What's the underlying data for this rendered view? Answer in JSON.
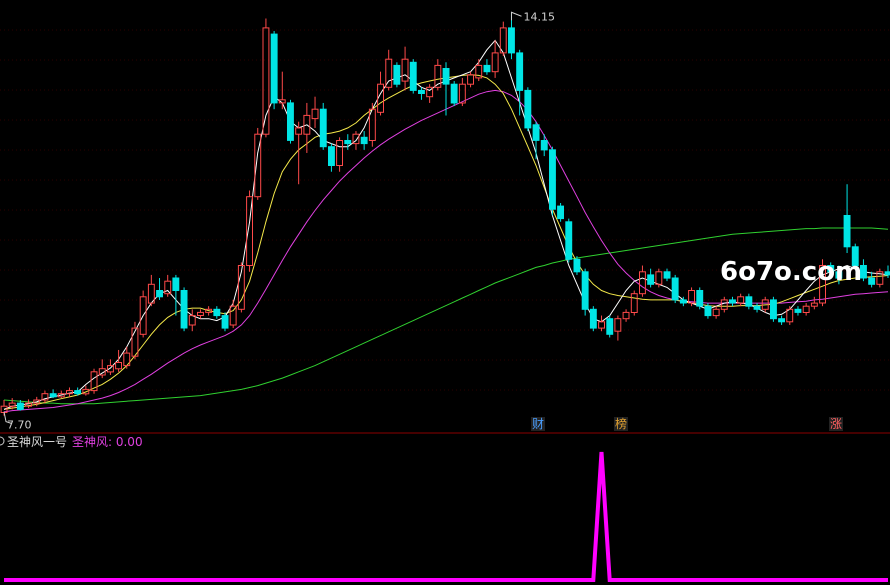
{
  "colors": {
    "background": "#000000",
    "up": "#ff4a4a",
    "down": "#00e5e5",
    "ma5": "#ffffff",
    "ma10": "#f5e94a",
    "ma20": "#e040e0",
    "ma60": "#30d030",
    "grid": "#8b0000",
    "indicator": "#ff00ff"
  },
  "price_chart": {
    "high_label": "14.15",
    "low_label": "7.70",
    "watermark": "6o7o.com",
    "event_markers": [
      {
        "text": "财",
        "color": "#4a9eff",
        "bg": "#222"
      },
      {
        "text": "榜",
        "color": "#e0a030",
        "bg": "#222"
      },
      {
        "text": "涨",
        "color": "#ff6060",
        "bg": "#222"
      }
    ]
  },
  "indicator_panel": {
    "title": "圣神风一号",
    "series_label": "圣神风: 0.00"
  },
  "chart_data": [
    {
      "type": "candlestick",
      "ylim": [
        7.55,
        14.25
      ],
      "max_price": 14.15,
      "min_price": 7.7,
      "candles": [
        [
          7.75,
          7.85,
          7.7,
          7.95
        ],
        [
          7.85,
          7.9,
          7.8,
          7.98
        ],
        [
          7.9,
          7.8,
          7.78,
          7.95
        ],
        [
          7.85,
          7.9,
          7.82,
          7.96
        ],
        [
          7.9,
          7.95,
          7.85,
          8.0
        ],
        [
          7.95,
          8.05,
          7.9,
          8.1
        ],
        [
          8.05,
          8.0,
          7.98,
          8.12
        ],
        [
          8.0,
          8.05,
          7.98,
          8.1
        ],
        [
          8.05,
          8.1,
          8.0,
          8.15
        ],
        [
          8.1,
          8.05,
          8.02,
          8.15
        ],
        [
          8.05,
          8.12,
          8.02,
          8.18
        ],
        [
          8.1,
          8.4,
          8.05,
          8.45
        ],
        [
          8.35,
          8.45,
          8.3,
          8.6
        ],
        [
          8.4,
          8.5,
          8.35,
          8.6
        ],
        [
          8.45,
          8.55,
          8.4,
          8.75
        ],
        [
          8.5,
          8.7,
          8.45,
          8.8
        ],
        [
          8.65,
          9.1,
          8.6,
          9.2
        ],
        [
          9.0,
          9.6,
          8.95,
          9.7
        ],
        [
          9.5,
          9.8,
          9.45,
          9.95
        ],
        [
          9.7,
          9.6,
          9.55,
          9.9
        ],
        [
          9.65,
          9.85,
          9.6,
          9.95
        ],
        [
          9.9,
          9.7,
          9.3,
          9.95
        ],
        [
          9.7,
          9.1,
          9.05,
          9.75
        ],
        [
          9.15,
          9.3,
          9.05,
          9.4
        ],
        [
          9.3,
          9.35,
          9.25,
          9.4
        ],
        [
          9.35,
          9.4,
          9.3,
          9.45
        ],
        [
          9.4,
          9.3,
          9.25,
          9.45
        ],
        [
          9.3,
          9.1,
          9.05,
          9.35
        ],
        [
          9.15,
          9.45,
          9.1,
          9.55
        ],
        [
          9.4,
          10.1,
          9.35,
          10.15
        ],
        [
          10.1,
          11.2,
          10.0,
          11.3
        ],
        [
          11.2,
          12.2,
          11.15,
          12.3
        ],
        [
          12.2,
          13.9,
          12.15,
          14.05
        ],
        [
          13.8,
          12.7,
          12.6,
          13.85
        ],
        [
          12.7,
          12.75,
          12.6,
          13.2
        ],
        [
          12.7,
          12.1,
          12.05,
          12.75
        ],
        [
          12.2,
          12.3,
          11.4,
          12.4
        ],
        [
          12.2,
          12.5,
          11.9,
          12.7
        ],
        [
          12.45,
          12.6,
          12.3,
          12.8
        ],
        [
          12.6,
          12.0,
          11.95,
          12.7
        ],
        [
          12.0,
          11.7,
          11.6,
          12.05
        ],
        [
          11.7,
          12.1,
          11.6,
          12.15
        ],
        [
          12.1,
          12.05,
          11.95,
          12.2
        ],
        [
          12.05,
          12.2,
          11.95,
          12.25
        ],
        [
          12.15,
          12.05,
          11.95,
          12.25
        ],
        [
          12.1,
          12.6,
          12.0,
          12.7
        ],
        [
          12.55,
          13.0,
          12.5,
          13.2
        ],
        [
          12.95,
          13.4,
          12.9,
          13.55
        ],
        [
          13.3,
          13.0,
          12.95,
          13.35
        ],
        [
          13.05,
          13.4,
          12.9,
          13.6
        ],
        [
          13.35,
          12.9,
          12.85,
          13.4
        ],
        [
          12.9,
          12.85,
          12.75,
          12.95
        ],
        [
          12.8,
          12.95,
          12.7,
          13.0
        ],
        [
          12.95,
          13.3,
          12.9,
          13.4
        ],
        [
          13.25,
          13.0,
          12.5,
          13.35
        ],
        [
          13.0,
          12.7,
          12.65,
          13.05
        ],
        [
          12.7,
          13.0,
          12.65,
          13.1
        ],
        [
          13.0,
          13.15,
          12.95,
          13.2
        ],
        [
          13.1,
          13.3,
          13.05,
          13.4
        ],
        [
          13.3,
          13.2,
          13.15,
          13.4
        ],
        [
          13.2,
          13.5,
          13.1,
          13.7
        ],
        [
          13.5,
          13.9,
          13.45,
          14.0
        ],
        [
          13.9,
          13.5,
          13.4,
          14.15
        ],
        [
          13.5,
          12.9,
          12.5,
          13.55
        ],
        [
          12.9,
          12.3,
          12.25,
          12.95
        ],
        [
          12.35,
          12.1,
          11.8,
          12.4
        ],
        [
          12.1,
          11.95,
          11.85,
          12.2
        ],
        [
          11.95,
          11.0,
          10.9,
          12.0
        ],
        [
          11.05,
          10.85,
          10.8,
          11.1
        ],
        [
          10.8,
          10.2,
          10.15,
          10.85
        ],
        [
          10.2,
          10.0,
          9.95,
          10.25
        ],
        [
          10.0,
          9.4,
          9.3,
          10.05
        ],
        [
          9.4,
          9.1,
          9.05,
          9.45
        ],
        [
          9.1,
          9.2,
          9.05,
          9.3
        ],
        [
          9.25,
          9.0,
          8.95,
          9.3
        ],
        [
          9.05,
          9.25,
          8.9,
          9.3
        ],
        [
          9.25,
          9.35,
          9.2,
          9.4
        ],
        [
          9.35,
          9.65,
          9.3,
          9.7
        ],
        [
          9.65,
          10.0,
          9.6,
          10.1
        ],
        [
          9.95,
          9.8,
          9.75,
          10.05
        ],
        [
          9.8,
          10.0,
          9.75,
          10.05
        ],
        [
          10.0,
          9.9,
          9.85,
          10.05
        ],
        [
          9.9,
          9.55,
          9.5,
          9.95
        ],
        [
          9.55,
          9.5,
          9.45,
          9.6
        ],
        [
          9.5,
          9.7,
          9.45,
          9.75
        ],
        [
          9.7,
          9.45,
          9.4,
          9.75
        ],
        [
          9.45,
          9.3,
          9.25,
          9.5
        ],
        [
          9.3,
          9.4,
          9.25,
          9.45
        ],
        [
          9.4,
          9.55,
          9.35,
          9.6
        ],
        [
          9.55,
          9.5,
          9.45,
          9.6
        ],
        [
          9.5,
          9.6,
          9.45,
          9.65
        ],
        [
          9.6,
          9.45,
          9.4,
          9.65
        ],
        [
          9.45,
          9.4,
          9.35,
          9.5
        ],
        [
          9.4,
          9.55,
          9.35,
          9.6
        ],
        [
          9.55,
          9.25,
          9.2,
          9.6
        ],
        [
          9.25,
          9.2,
          9.15,
          9.3
        ],
        [
          9.2,
          9.4,
          9.15,
          9.45
        ],
        [
          9.4,
          9.35,
          9.3,
          9.45
        ],
        [
          9.35,
          9.45,
          9.3,
          9.5
        ],
        [
          9.45,
          9.5,
          9.4,
          9.6
        ],
        [
          9.5,
          10.1,
          9.45,
          10.2
        ],
        [
          10.1,
          10.0,
          9.95,
          10.15
        ],
        [
          10.0,
          9.9,
          9.8,
          10.1
        ],
        [
          10.9,
          10.4,
          10.3,
          11.4
        ],
        [
          10.4,
          10.1,
          10.05,
          10.45
        ],
        [
          10.1,
          9.9,
          9.85,
          10.2
        ],
        [
          9.9,
          9.8,
          9.75,
          10.0
        ],
        [
          9.8,
          10.0,
          9.75,
          10.05
        ],
        [
          10.0,
          9.95,
          9.9,
          10.1
        ]
      ],
      "ma5": [
        7.8,
        7.85,
        7.87,
        7.89,
        7.92,
        7.97,
        8.0,
        8.03,
        8.06,
        8.08,
        8.2,
        8.3,
        8.38,
        8.46,
        8.6,
        8.8,
        9.05,
        9.3,
        9.5,
        9.65,
        9.7,
        9.55,
        9.4,
        9.3,
        9.25,
        9.25,
        9.22,
        9.28,
        9.5,
        10.0,
        10.8,
        11.9,
        12.5,
        12.8,
        12.7,
        12.4,
        12.3,
        12.35,
        12.25,
        12.1,
        12.05,
        12.0,
        12.0,
        12.1,
        12.3,
        12.6,
        12.85,
        13.05,
        13.1,
        13.15,
        13.05,
        12.95,
        12.9,
        13.0,
        13.05,
        13.1,
        13.15,
        13.2,
        13.35,
        13.55,
        13.7,
        13.5,
        13.1,
        12.7,
        12.3,
        11.9,
        11.4,
        10.9,
        10.5,
        10.1,
        9.8,
        9.5,
        9.25,
        9.2,
        9.3,
        9.5,
        9.7,
        9.85,
        9.9,
        9.85,
        9.8,
        9.75,
        9.65,
        9.55,
        9.5,
        9.45,
        9.4,
        9.45,
        9.5,
        9.52,
        9.5,
        9.48,
        9.42,
        9.35,
        9.3,
        9.32,
        9.4,
        9.55,
        9.7,
        9.85,
        9.95,
        10.0,
        10.05,
        10.1,
        10.05,
        10.0,
        9.98,
        9.97,
        9.95
      ],
      "ma10": [
        7.8,
        7.82,
        7.84,
        7.86,
        7.88,
        7.91,
        7.94,
        7.97,
        8.0,
        8.03,
        8.08,
        8.14,
        8.2,
        8.28,
        8.38,
        8.5,
        8.66,
        8.83,
        9.0,
        9.15,
        9.27,
        9.35,
        9.4,
        9.42,
        9.42,
        9.38,
        9.35,
        9.33,
        9.38,
        9.55,
        9.85,
        10.3,
        10.8,
        11.25,
        11.6,
        11.8,
        11.95,
        12.05,
        12.15,
        12.2,
        12.22,
        12.25,
        12.3,
        12.38,
        12.5,
        12.6,
        12.7,
        12.78,
        12.85,
        12.92,
        12.98,
        13.02,
        13.05,
        13.08,
        13.1,
        13.12,
        13.14,
        13.15,
        13.14,
        13.1,
        13.0,
        12.85,
        12.6,
        12.3,
        12.0,
        11.7,
        11.35,
        11.0,
        10.7,
        10.4,
        10.15,
        9.95,
        9.8,
        9.7,
        9.65,
        9.62,
        9.6,
        9.58,
        9.56,
        9.55,
        9.55,
        9.55,
        9.55,
        9.52,
        9.5,
        9.48,
        9.46,
        9.45,
        9.45,
        9.45,
        9.46,
        9.46,
        9.46,
        9.47,
        9.48,
        9.52,
        9.57,
        9.62,
        9.67,
        9.72,
        9.77,
        9.82,
        9.86,
        9.88,
        9.9,
        9.91,
        9.92,
        9.93,
        9.94
      ],
      "ma20": [
        7.76,
        7.78,
        7.79,
        7.8,
        7.81,
        7.82,
        7.83,
        7.85,
        7.87,
        7.89,
        7.92,
        7.95,
        7.98,
        8.02,
        8.07,
        8.13,
        8.2,
        8.28,
        8.36,
        8.45,
        8.54,
        8.62,
        8.7,
        8.77,
        8.83,
        8.88,
        8.93,
        8.98,
        9.05,
        9.15,
        9.3,
        9.5,
        9.72,
        9.95,
        10.18,
        10.4,
        10.6,
        10.8,
        10.98,
        11.15,
        11.3,
        11.45,
        11.58,
        11.7,
        11.82,
        11.93,
        12.03,
        12.12,
        12.2,
        12.28,
        12.35,
        12.42,
        12.48,
        12.54,
        12.6,
        12.66,
        12.72,
        12.78,
        12.84,
        12.88,
        12.9,
        12.88,
        12.82,
        12.72,
        12.58,
        12.4,
        12.18,
        11.95,
        11.7,
        11.45,
        11.2,
        10.95,
        10.72,
        10.5,
        10.3,
        10.12,
        9.98,
        9.86,
        9.76,
        9.68,
        9.62,
        9.58,
        9.55,
        9.53,
        9.52,
        9.51,
        9.5,
        9.5,
        9.5,
        9.5,
        9.5,
        9.5,
        9.5,
        9.5,
        9.5,
        9.5,
        9.51,
        9.52,
        9.53,
        9.55,
        9.56,
        9.58,
        9.6,
        9.62,
        9.64,
        9.65,
        9.66,
        9.67,
        9.68
      ],
      "ma60": [
        7.95,
        7.94,
        7.93,
        7.92,
        7.91,
        7.9,
        7.9,
        7.89,
        7.89,
        7.89,
        7.89,
        7.89,
        7.9,
        7.91,
        7.92,
        7.93,
        7.94,
        7.95,
        7.96,
        7.97,
        7.98,
        7.99,
        8.0,
        8.01,
        8.02,
        8.04,
        8.06,
        8.08,
        8.1,
        8.12,
        8.15,
        8.18,
        8.22,
        8.26,
        8.3,
        8.35,
        8.4,
        8.45,
        8.5,
        8.56,
        8.62,
        8.68,
        8.74,
        8.8,
        8.86,
        8.92,
        8.98,
        9.04,
        9.1,
        9.16,
        9.22,
        9.28,
        9.34,
        9.4,
        9.46,
        9.52,
        9.58,
        9.64,
        9.7,
        9.76,
        9.82,
        9.87,
        9.92,
        9.97,
        10.02,
        10.07,
        10.1,
        10.14,
        10.17,
        10.2,
        10.22,
        10.24,
        10.26,
        10.28,
        10.3,
        10.32,
        10.34,
        10.36,
        10.38,
        10.4,
        10.42,
        10.44,
        10.46,
        10.48,
        10.5,
        10.52,
        10.54,
        10.56,
        10.58,
        10.6,
        10.61,
        10.62,
        10.63,
        10.64,
        10.65,
        10.66,
        10.67,
        10.68,
        10.69,
        10.69,
        10.7,
        10.7,
        10.7,
        10.7,
        10.7,
        10.7,
        10.7,
        10.69,
        10.68
      ]
    },
    {
      "type": "line",
      "series": [
        {
          "name": "圣神风",
          "values": [
            0,
            0,
            0,
            0,
            0,
            0,
            0,
            0,
            0,
            0,
            0,
            0,
            0,
            0,
            0,
            0,
            0,
            0,
            0,
            0,
            0,
            0,
            0,
            0,
            0,
            0,
            0,
            0,
            0,
            0,
            0,
            0,
            0,
            0,
            0,
            0,
            0,
            0,
            0,
            0,
            0,
            0,
            0,
            0,
            0,
            0,
            0,
            0,
            0,
            0,
            0,
            0,
            0,
            0,
            0,
            0,
            0,
            0,
            0,
            0,
            0,
            0,
            0,
            0,
            0,
            0,
            0,
            0,
            0,
            0,
            0,
            0,
            0,
            1,
            0,
            0,
            0,
            0,
            0,
            0,
            0,
            0,
            0,
            0,
            0,
            0,
            0,
            0,
            0,
            0,
            0,
            0,
            0,
            0,
            0,
            0,
            0,
            0,
            0,
            0,
            0,
            0,
            0,
            0,
            0,
            0,
            0,
            0,
            0
          ]
        }
      ],
      "ylim": [
        0,
        1
      ]
    }
  ]
}
